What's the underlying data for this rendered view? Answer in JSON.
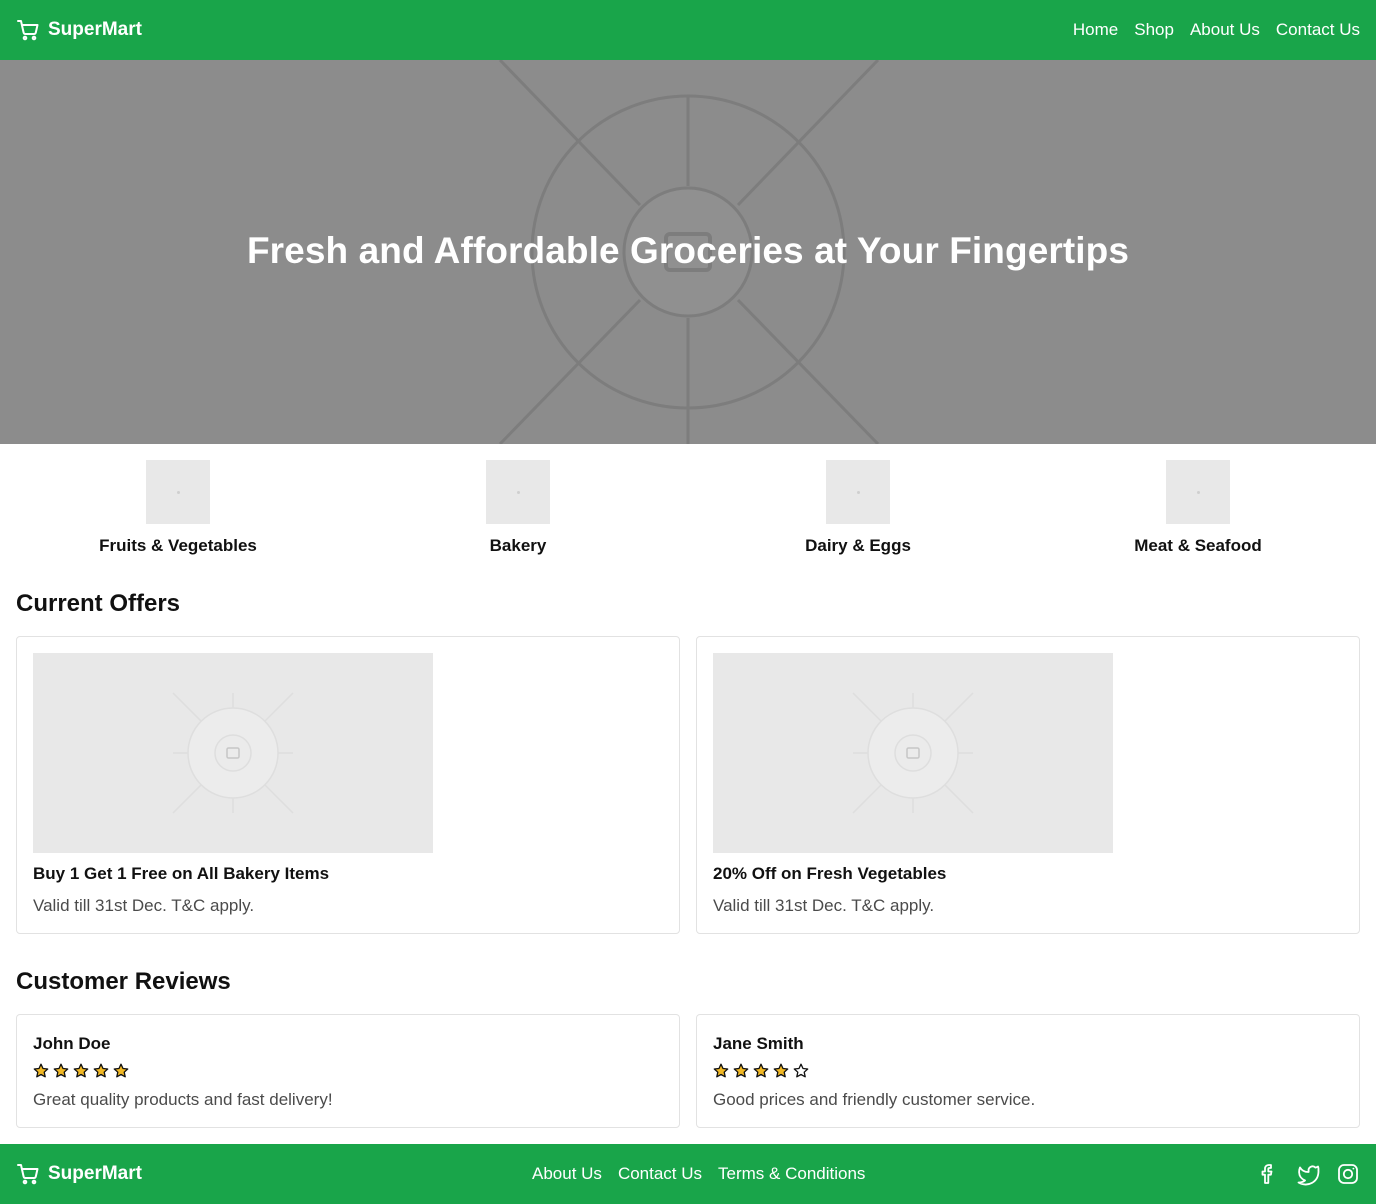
{
  "header": {
    "brand": "SuperMart",
    "nav": [
      "Home",
      "Shop",
      "About Us",
      "Contact Us"
    ]
  },
  "hero": {
    "title": "Fresh and Affordable Groceries at Your Fingertips"
  },
  "categories": [
    "Fruits & Vegetables",
    "Bakery",
    "Dairy & Eggs",
    "Meat & Seafood"
  ],
  "offers": {
    "title": "Current Offers",
    "items": [
      {
        "title": "Buy 1 Get 1 Free on All Bakery Items",
        "subtitle": "Valid till 31st Dec. T&C apply."
      },
      {
        "title": "20% Off on Fresh Vegetables",
        "subtitle": "Valid till 31st Dec. T&C apply."
      }
    ]
  },
  "reviews": {
    "title": "Customer Reviews",
    "items": [
      {
        "name": "John Doe",
        "rating": 5,
        "max_rating": 5,
        "text": "Great quality products and fast delivery!"
      },
      {
        "name": "Jane Smith",
        "rating": 4,
        "max_rating": 5,
        "text": "Good prices and friendly customer service."
      }
    ]
  },
  "footer": {
    "brand": "SuperMart",
    "links": [
      "About Us",
      "Contact Us",
      "Terms & Conditions"
    ],
    "social": [
      "facebook-icon",
      "twitter-icon",
      "instagram-icon"
    ]
  },
  "colors": {
    "brand_green": "#19a54a",
    "star_fill": "#f2b926",
    "hero_bg": "#8c8c8c"
  }
}
